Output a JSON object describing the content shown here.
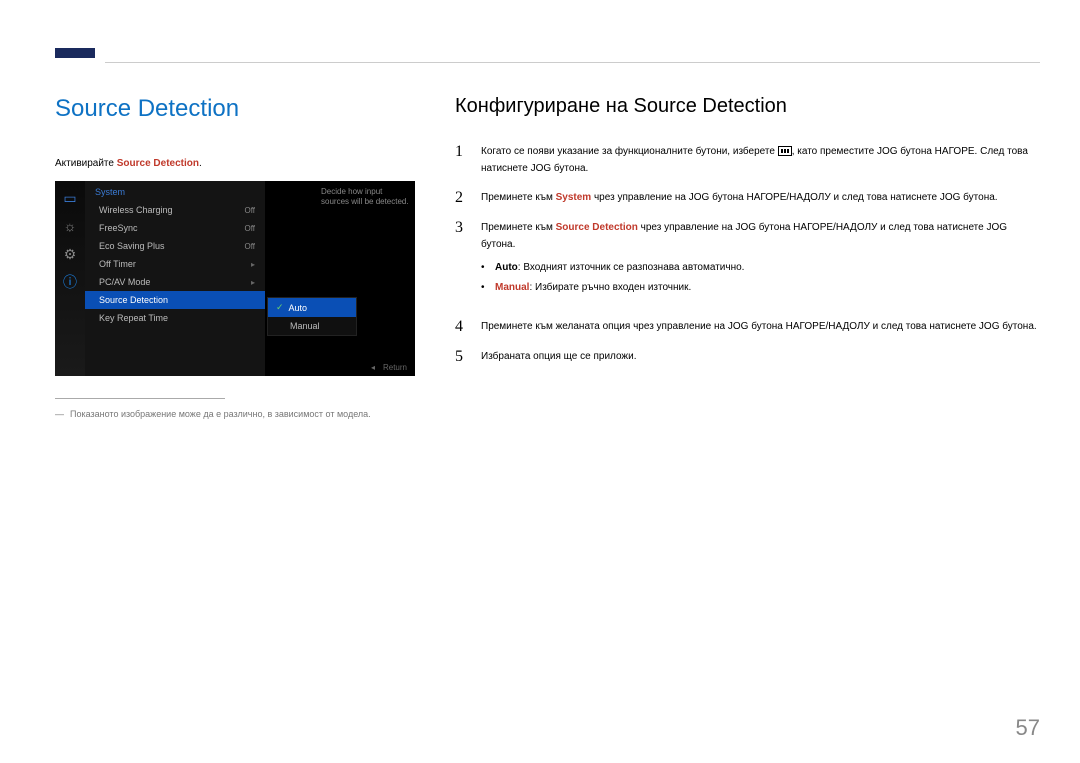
{
  "page_number": "57",
  "left": {
    "title": "Source Detection",
    "intro_prefix": "Активирайте ",
    "intro_highlight": "Source Detection",
    "intro_suffix": ".",
    "footnote_marker": "―",
    "footnote": "Показаното изображение може да е различно, в зависимост от модела."
  },
  "osd": {
    "menu_title": "System",
    "help_text": "Decide how input sources will be detected.",
    "footer_return": "Return",
    "footer_arrow": "◂",
    "items": [
      {
        "label": "Wireless Charging",
        "value": "Off"
      },
      {
        "label": "FreeSync",
        "value": "Off"
      },
      {
        "label": "Eco Saving Plus",
        "value": "Off"
      },
      {
        "label": "Off Timer",
        "value": "▸"
      },
      {
        "label": "PC/AV Mode",
        "value": "▸"
      },
      {
        "label": "Source Detection",
        "value": ""
      },
      {
        "label": "Key Repeat Time",
        "value": ""
      }
    ],
    "submenu": {
      "items": [
        {
          "label": "Auto",
          "selected": true
        },
        {
          "label": "Manual",
          "selected": false
        }
      ]
    }
  },
  "right": {
    "subtitle": "Конфигуриране на Source Detection",
    "steps": {
      "s1_a": "Когато се появи указание за функционалните бутони, изберете ",
      "s1_b": ", като преместите JOG бутона НАГОРЕ. След това натиснете JOG бутона.",
      "s2_a": "Преминете към ",
      "s2_hl": "System",
      "s2_b": " чрез управление на JOG бутона НАГОРЕ/НАДОЛУ и след това натиснете JOG бутона.",
      "s3_a": "Преминете към ",
      "s3_hl": "Source Detection",
      "s3_b": " чрез управление на JOG бутона НАГОРЕ/НАДОЛУ и след това натиснете JOG бутона.",
      "b1_label": "Auto",
      "b1_text": ": Входният източник се разпознава автоматично.",
      "b2_label": "Manual",
      "b2_text": ": Избирате ръчно входен източник.",
      "s4": "Преминете към желаната опция чрез управление на JOG бутона НАГОРЕ/НАДОЛУ и след това натиснете JOG бутона.",
      "s5": "Избраната опция ще се приложи."
    },
    "nums": {
      "n1": "1",
      "n2": "2",
      "n3": "3",
      "n4": "4",
      "n5": "5"
    }
  }
}
